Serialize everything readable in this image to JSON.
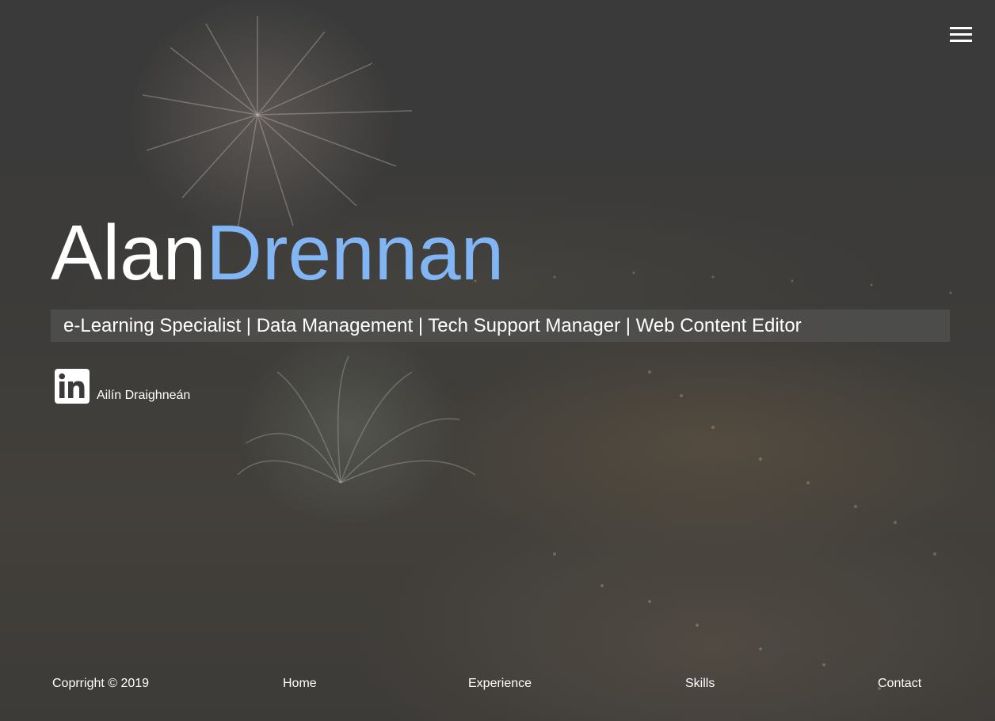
{
  "header": {
    "menu_icon": "hamburger-menu-icon"
  },
  "hero": {
    "first_name": "Alan",
    "last_name": "Drennan",
    "tagline": "e-Learning Specialist | Data Management | Tech Support Manager | Web Content Editor",
    "accent_color": "#82b5f3"
  },
  "social": {
    "icon": "linkedin-icon",
    "label": "Ailín Draighneán"
  },
  "footer": {
    "copyright": "Coprright © 2019",
    "nav": {
      "home": "Home",
      "experience": "Experience",
      "skills": "Skills",
      "contact": "Contact"
    }
  }
}
